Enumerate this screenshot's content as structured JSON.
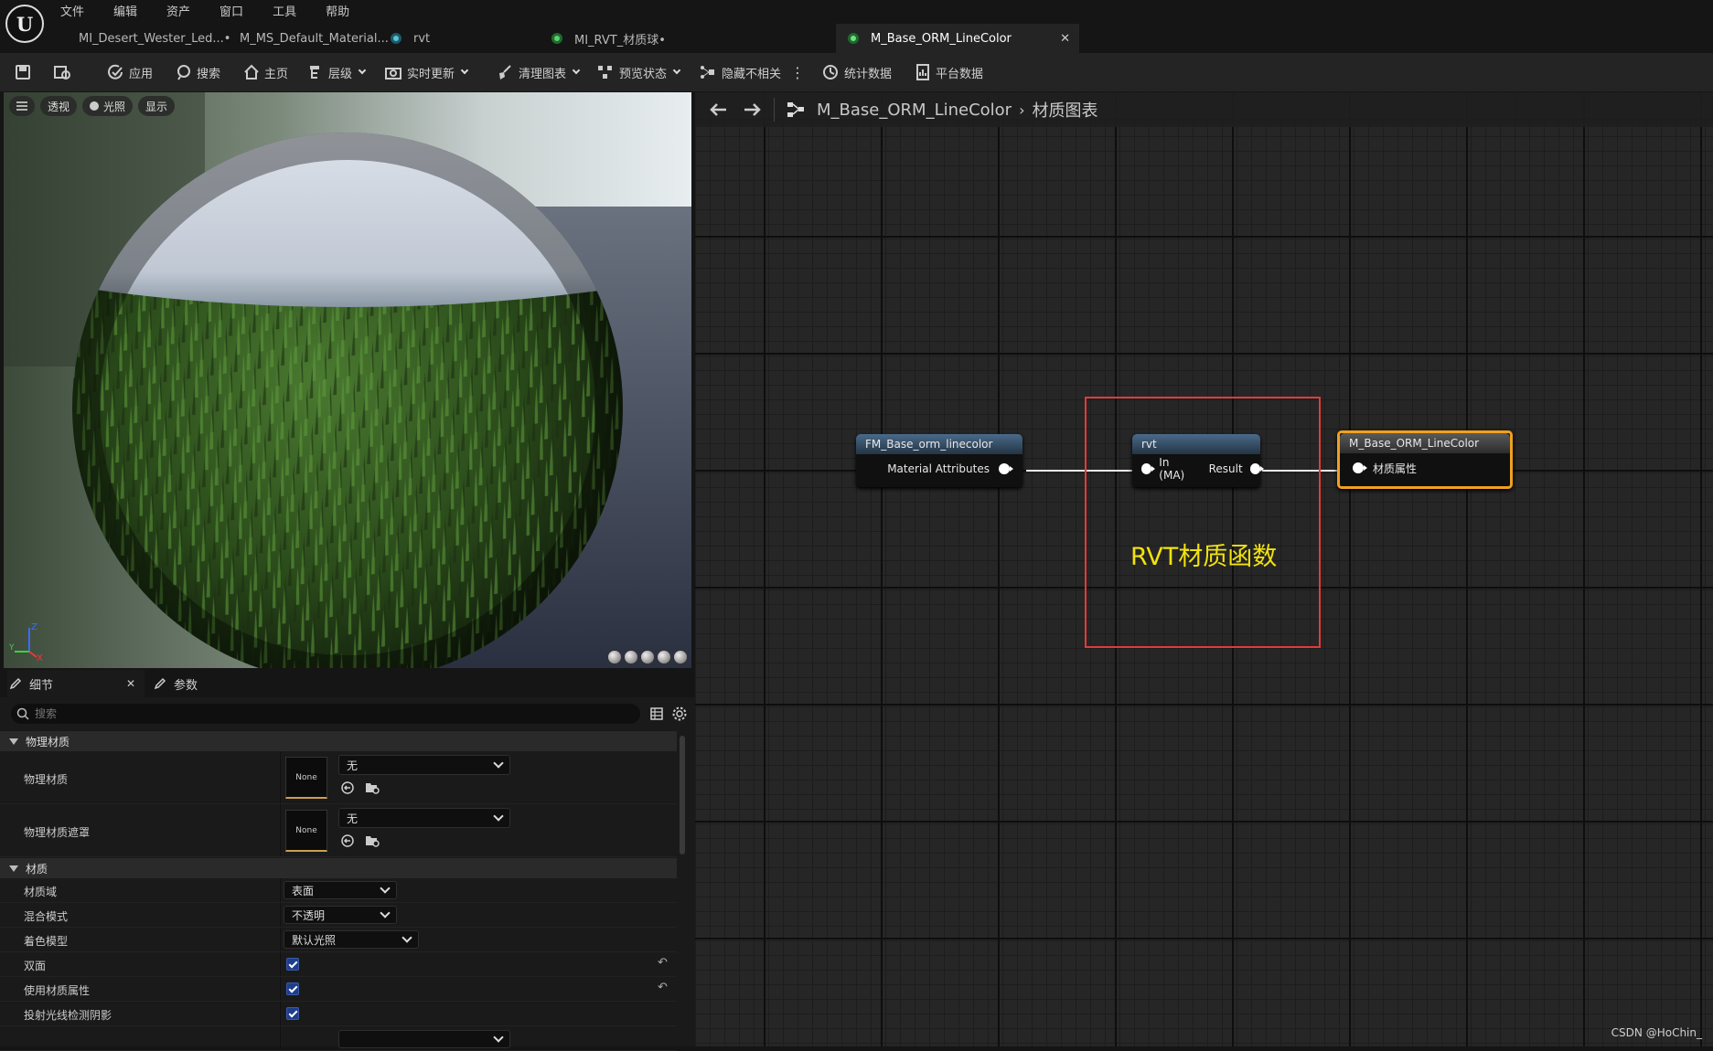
{
  "menu": [
    "文件",
    "编辑",
    "资产",
    "窗口",
    "工具",
    "帮助"
  ],
  "tabs": [
    {
      "label": "MI_Desert_Wester_Led...•",
      "active": false
    },
    {
      "label": "M_MS_Default_Material...",
      "active": false
    },
    {
      "label": "rvt",
      "active": false
    },
    {
      "label": "MI_RVT_材质球•",
      "active": false
    },
    {
      "label": "M_Base_ORM_LineColor",
      "active": true
    }
  ],
  "toolbar": {
    "apply": "应用",
    "search": "搜索",
    "home": "主页",
    "hierarchy": "层级",
    "live_update": "实时更新",
    "clean_graph": "清理图表",
    "preview_state": "预览状态",
    "hide_unrelated": "隐藏不相关",
    "stats": "统计数据",
    "platform_stats": "平台数据"
  },
  "viewport": {
    "perspective": "透视",
    "lighting": "光照",
    "show": "显示",
    "axis_z": "Z",
    "axis_y": "Y",
    "axis_x": "X"
  },
  "details": {
    "tab_details": "细节",
    "tab_params": "参数",
    "search_placeholder": "搜索",
    "section_phys": "物理材质",
    "phys_mat_label": "物理材质",
    "phys_mat_thumb": "None",
    "phys_mat_value": "无",
    "phys_mask_label": "物理材质遮罩",
    "phys_mask_thumb": "None",
    "phys_mask_value": "无",
    "section_mat": "材质",
    "domain_label": "材质域",
    "domain_value": "表面",
    "blend_label": "混合模式",
    "blend_value": "不透明",
    "shading_label": "着色模型",
    "shading_value": "默认光照",
    "two_sided_label": "双面",
    "use_attr_label": "使用材质属性",
    "raytrace_label": "投射光线检测阴影"
  },
  "graph": {
    "breadcrumb_asset": "M_Base_ORM_LineColor",
    "breadcrumb_graph": "材质图表",
    "node1_title": "FM_Base_orm_linecolor",
    "node1_out": "Material Attributes",
    "node2_title": "rvt",
    "node2_in": "In (MA)",
    "node2_out": "Result",
    "node3_title": "M_Base_ORM_LineColor",
    "node3_in": "材质属性",
    "annotation": "RVT材质函数",
    "watermark": "CSDN @HoChin_"
  },
  "colors": {
    "accent_orange": "#f0a020",
    "annotation_red": "#e23a3a",
    "annotation_yellow": "#f2e20f",
    "checkbox_blue": "#1e3e8c"
  }
}
